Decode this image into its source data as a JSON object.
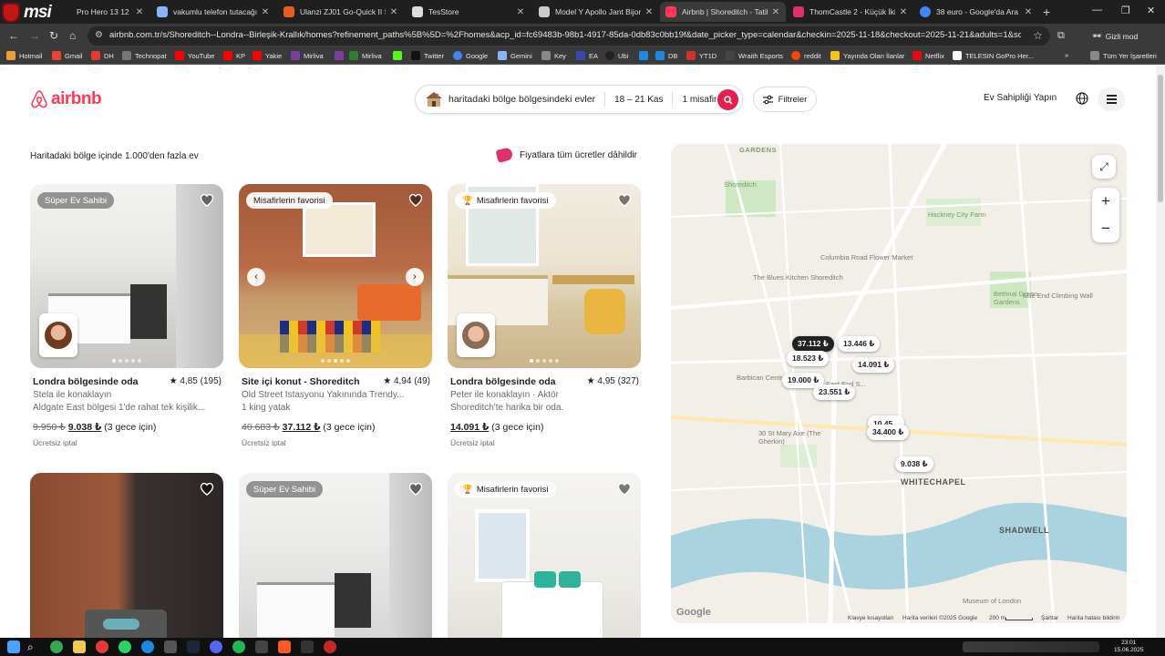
{
  "browser": {
    "brand": "msi",
    "tabs": [
      {
        "title": "Pro Hero 13 12 ...",
        "color": "#e0e0e0"
      },
      {
        "title": "vakumlu telefon tutacağı - G",
        "color": "#8ab4f8"
      },
      {
        "title": "Ulanzi ZJ01 Go-Quick II Suct",
        "color": "#e85c1f"
      },
      {
        "title": "TesStore",
        "color": "#dddddd"
      },
      {
        "title": "Model Y Apollo Jant Bijon K",
        "color": "#cccccc"
      },
      {
        "title": "Airbnb | Shoreditch - Tatil Ar",
        "color": "#ff385c"
      },
      {
        "title": "ThomCastle 2 - Küçük İkiz S",
        "color": "#e0306a"
      },
      {
        "title": "38 euro - Google'da Ara",
        "color": "#4285f4"
      }
    ],
    "url": "airbnb.com.tr/s/Shoreditch--Londra--Birleşik-Krallık/homes?refinement_paths%5B%5D=%2Fhomes&acp_id=fc69483b-98b1-4917-85da-0db83c0bb19f&date_picker_type=calendar&checkin=2025-11-18&checkout=2025-11-21&adults=1&source=structured_...",
    "incognito": "Gizli mod",
    "bookmarks": [
      {
        "label": "Hotmail",
        "color": "#f0a030"
      },
      {
        "label": "Gmail",
        "color": "#ea4335"
      },
      {
        "label": "DH",
        "color": "#e53935"
      },
      {
        "label": "Technopat",
        "color": "#777777"
      },
      {
        "label": "YouTube",
        "color": "#ff0000"
      },
      {
        "label": "KP",
        "color": "#ff0000"
      },
      {
        "label": "Yakie",
        "color": "#ff0000"
      },
      {
        "label": "Mirliva",
        "color": "#7b3fa0"
      },
      {
        "label": "",
        "color": "#7b3fa0"
      },
      {
        "label": "Mirliva",
        "color": "#2e7d32"
      },
      {
        "label": "",
        "color": "#53fc18"
      },
      {
        "label": "Twitter",
        "color": "#111111"
      },
      {
        "label": "Google",
        "color": "#4285f4"
      },
      {
        "label": "Gemini",
        "color": "#8ab4f8"
      },
      {
        "label": "Key",
        "color": "#888888"
      },
      {
        "label": "EA",
        "color": "#3949ab"
      },
      {
        "label": "Ubi",
        "color": "#222222"
      },
      {
        "label": "",
        "color": "#1e88e5"
      },
      {
        "label": "DB",
        "color": "#1e88e5"
      },
      {
        "label": "YT1D",
        "color": "#d32f2f"
      },
      {
        "label": "Wraith Esports",
        "color": "#444444"
      },
      {
        "label": "reddit",
        "color": "#ff4500"
      },
      {
        "label": "Yayında Olan İlanlar",
        "color": "#f5c518"
      },
      {
        "label": "Netflix",
        "color": "#e50914"
      },
      {
        "label": "TELESIN GoPro Her...",
        "color": "#ffffff"
      }
    ],
    "all_bookmarks": "Tüm Yer İşaretleri"
  },
  "header": {
    "logo": "airbnb",
    "location": "haritadaki bölge bölgesindeki evler",
    "dates": "18 – 21 Kas",
    "guests": "1 misafir",
    "filters": "Filtreler",
    "host": "Ev Sahipliği Yapın"
  },
  "results": {
    "count_text": "Haritadaki bölge içinde 1.000'den fazla ev",
    "price_note": "Fiyatlara tüm ücretler dâhildir"
  },
  "listings": [
    {
      "badge": "Süper Ev Sahibi",
      "title": "Londra bölgesinde oda",
      "rating": "★ 4,85 (195)",
      "line1": "Stela ile konaklayın",
      "line2": "Aldgate East bölgesi 1'de rahat tek kişilik...",
      "old_price": "9.950 ₺",
      "price": "9.038 ₺",
      "nights": " (3 gece için)",
      "free": "Ücretsiz iptal"
    },
    {
      "badge": "Misafirlerin favorisi",
      "title": "Site içi konut - Shoreditch",
      "rating": "★ 4,94 (49)",
      "line1": "Old Street İstasyonu Yakınında Trendy...",
      "line2": "1 king yatak",
      "old_price": "40.683 ₺",
      "price": "37.112 ₺",
      "nights": " (3 gece için)",
      "free": "Ücretsiz iptal"
    },
    {
      "badge": "Misafirlerin favorisi",
      "title": "Londra bölgesinde oda",
      "rating": "★ 4,95 (327)",
      "line1": "Peter ile konaklayın · Aktör",
      "line2": "Shoreditch'te harika bir oda.",
      "old_price": "",
      "price": "14.091 ₺",
      "nights": " (3 gece için)",
      "free": "Ücretsiz iptal"
    },
    {
      "badge": ""
    },
    {
      "badge": "Süper Ev Sahibi"
    },
    {
      "badge": "Misafirlerin favorisi"
    }
  ],
  "map": {
    "pins": [
      {
        "label": "37.112 ₺",
        "selected": true
      },
      {
        "label": "13.446 ₺",
        "selected": false
      },
      {
        "label": "18.523 ₺",
        "selected": false
      },
      {
        "label": "14.091 ₺",
        "selected": false
      },
      {
        "label": "19.000 ₺",
        "selected": false
      },
      {
        "label": "23.551 ₺",
        "selected": false
      },
      {
        "label": "10.45...",
        "selected": false
      },
      {
        "label": "34.400 ₺",
        "selected": false
      },
      {
        "label": "9.038 ₺",
        "selected": false
      }
    ],
    "labels": {
      "hackney": "Hackney City Farm",
      "columbia": "Columbia Road Flower Market",
      "bluesKitchen": "The Blues Kitchen Shoreditch",
      "mileEnd": "Mile End Climbing Wall",
      "bethnal": "Bethnal Green Gardens",
      "barbican": "Barbican Centre",
      "gherkin": "30 St Mary Axe (The Gherkin)",
      "museum": "Museum of London",
      "eastEnd": "East End S...",
      "gardens": "GARDENS",
      "shoreditchPark": "Shoreditch",
      "whitechapel": "WHITECHAPEL",
      "shadwell": "SHADWELL"
    },
    "footer": {
      "google": "Google",
      "shortcuts": "Klavye kısayolları",
      "data": "Harita verileri ©2025 Google",
      "scale": "200 m",
      "terms": "Şartlar",
      "report": "Harita hatası bildirin"
    }
  },
  "clock": {
    "time": "23:01",
    "date": "15.06.2025"
  }
}
